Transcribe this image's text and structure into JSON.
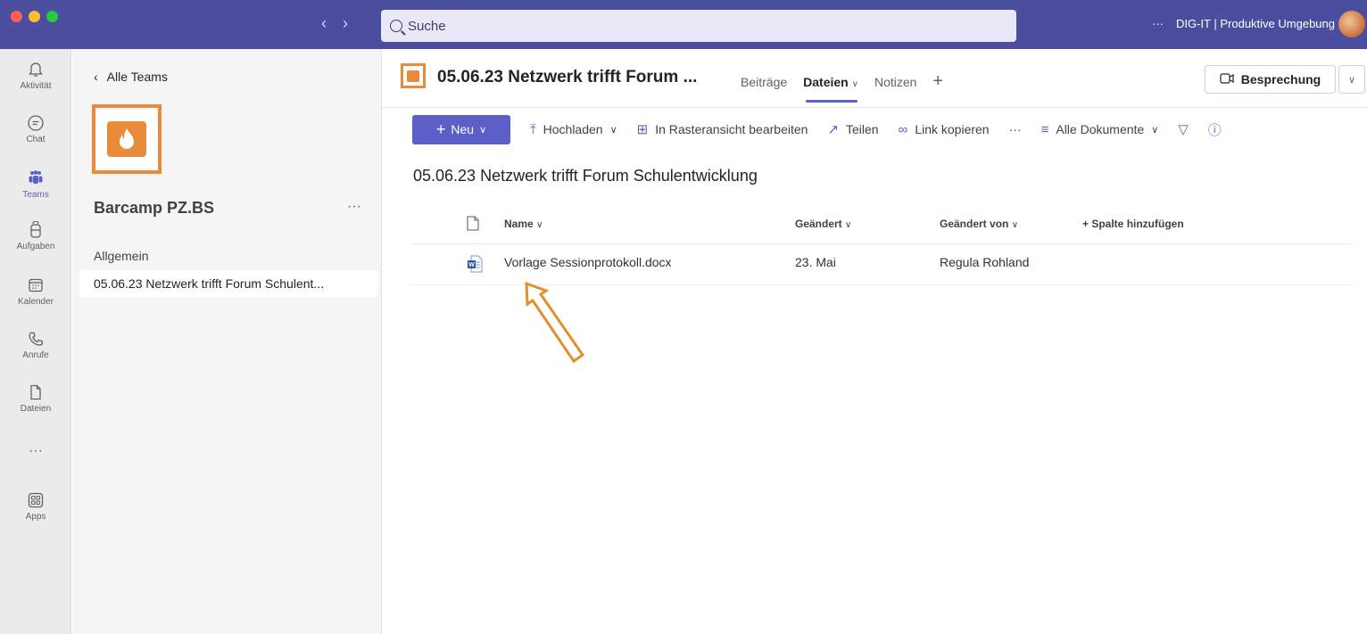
{
  "titlebar": {
    "search_placeholder": "Suche",
    "more": "···",
    "org": "DIG-IT | Produktive Umgebung"
  },
  "rail": [
    {
      "label": "Aktivität",
      "icon": "bell-icon"
    },
    {
      "label": "Chat",
      "icon": "chat-icon"
    },
    {
      "label": "Teams",
      "icon": "teams-icon"
    },
    {
      "label": "Aufgaben",
      "icon": "tasks-icon"
    },
    {
      "label": "Kalender",
      "icon": "calendar-icon"
    },
    {
      "label": "Anrufe",
      "icon": "phone-icon"
    },
    {
      "label": "Dateien",
      "icon": "file-icon"
    },
    {
      "label": "···",
      "icon": "more-icon"
    },
    {
      "label": "Apps",
      "icon": "apps-icon"
    }
  ],
  "teampanel": {
    "back": "Alle Teams",
    "team_name": "Barcamp PZ.BS",
    "team_more": "···",
    "channels": [
      "Allgemein",
      "05.06.23 Netzwerk trifft Forum Schulent..."
    ]
  },
  "header": {
    "channel_title": "05.06.23 Netzwerk trifft Forum ...",
    "tabs": [
      "Beiträge",
      "Dateien",
      "Notizen"
    ],
    "add_tab": "+",
    "meeting_label": "Besprechung"
  },
  "commands": {
    "new": "Neu",
    "upload": "Hochladen",
    "grid": "In Rasteransicht bearbeiten",
    "share": "Teilen",
    "copy_link": "Link kopieren",
    "more": "···",
    "view": "Alle Dokumente"
  },
  "library_title": "05.06.23 Netzwerk trifft Forum Schulentwicklung",
  "table": {
    "columns": [
      "Name",
      "Geändert",
      "Geändert von"
    ],
    "add_column": "+ Spalte hinzufügen",
    "rows": [
      {
        "name": "Vorlage Sessionprotokoll.docx",
        "modified": "23. Mai",
        "modified_by": "Regula Rohland"
      }
    ]
  },
  "colors": {
    "titlebar": "#4b4d9e",
    "accent": "#5b5fc7",
    "team_orange": "#e88b3a"
  }
}
